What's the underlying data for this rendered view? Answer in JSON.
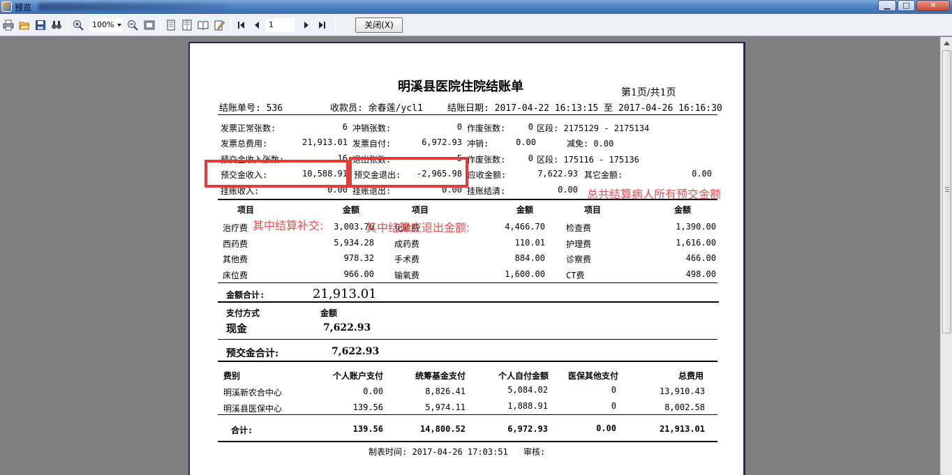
{
  "window": {
    "title": "预览",
    "min_glyph": "▁",
    "max_glyph": "□",
    "close_glyph": "✕"
  },
  "toolbar": {
    "zoom": "100%",
    "page": "1",
    "close_label": "关闭(X)"
  },
  "report": {
    "title": "明溪县医院住院结账单",
    "page_info": "第1页/共1页",
    "header": {
      "bill_no": "结账单号: 536",
      "cashier": "收款员: 余春莲/ycl1",
      "date": "结账日期: 2017-04-22 16:13:15 至 2017-04-26 16:16:30"
    },
    "summary": {
      "r1": {
        "label1": "发票正常张数:",
        "value1": "6",
        "label2": "冲销张数:",
        "value2": "0",
        "label3": "作废张数:",
        "value3": "0",
        "label4": "区段: 2175129 - 2175134"
      },
      "r2": {
        "label1": "发票总费用:",
        "value1": "21,913.01",
        "label2": "发票自付:",
        "value2": "6,972.93",
        "label3": "冲销:",
        "value3": "0.00",
        "label4": "减免: 0.00"
      },
      "r3": {
        "label1": "预交金收入张数:",
        "value1": "16",
        "label2": "退出张数:",
        "value2": "5",
        "label3": "作废张数:",
        "value3": "0",
        "label4": "区段: 175116 - 175136"
      },
      "r4": {
        "label1": "预交金收入:",
        "value1": "10,588.91",
        "label2": "预交金退出:",
        "value2": "-2,965.98",
        "label3": "应收金额:",
        "value3": "7,622.93",
        "label4": "其它金额:",
        "value4": "0.00"
      },
      "r5": {
        "label1": "挂账收入:",
        "value1": "0.00",
        "label2": "挂账退出:",
        "value2": "0.00",
        "label3": "挂账结清:",
        "value3": "0.00"
      }
    },
    "items": {
      "headers": [
        "项目",
        "金额",
        "项目",
        "金额",
        "项目",
        "金额"
      ],
      "rows": [
        [
          "治疗费",
          "3,003.76",
          "化验费",
          "4,466.70",
          "检查费",
          "1,390.00"
        ],
        [
          "西药费",
          "5,934.28",
          "成药费",
          "110.01",
          "护理费",
          "1,616.00"
        ],
        [
          "其他费",
          "978.32",
          "手术费",
          "884.00",
          "诊察费",
          "466.00"
        ],
        [
          "床位费",
          "966.00",
          "输氧费",
          "1,600.00",
          "CT费",
          "498.00"
        ]
      ]
    },
    "total": {
      "label": "金额合计:",
      "value": "21,913.01"
    },
    "payment": {
      "col1": "支付方式",
      "col2": "金额",
      "method": "现金",
      "amount": "7,622.93"
    },
    "deposit_total": {
      "label": "预交金合计:",
      "value": "7,622.93"
    },
    "insurance": {
      "headers": [
        "费别",
        "个人账户支付",
        "统筹基金支付",
        "个人自付金额",
        "医保其他支付",
        "总费用"
      ],
      "rows": [
        [
          "明溪新农合中心",
          "0.00",
          "8,826.41",
          "5,084.02",
          "0",
          "13,910.43"
        ],
        [
          "明溪县医保中心",
          "139.56",
          "5,974.11",
          "1,888.91",
          "0",
          "8,002.58"
        ]
      ],
      "total": [
        "合计:",
        "139.56",
        "14,800.52",
        "6,972.93",
        "0.00",
        "21,913.01"
      ]
    },
    "footer": {
      "made_time": "制表时间: 2017-04-26 17:03:51",
      "review": "审核:"
    }
  },
  "annotations": {
    "a1": "其中结算补交:",
    "a2": "其中结算应退出金额:",
    "a3": "总共结算病人所有预交金额",
    "color": "#e23b3b"
  }
}
